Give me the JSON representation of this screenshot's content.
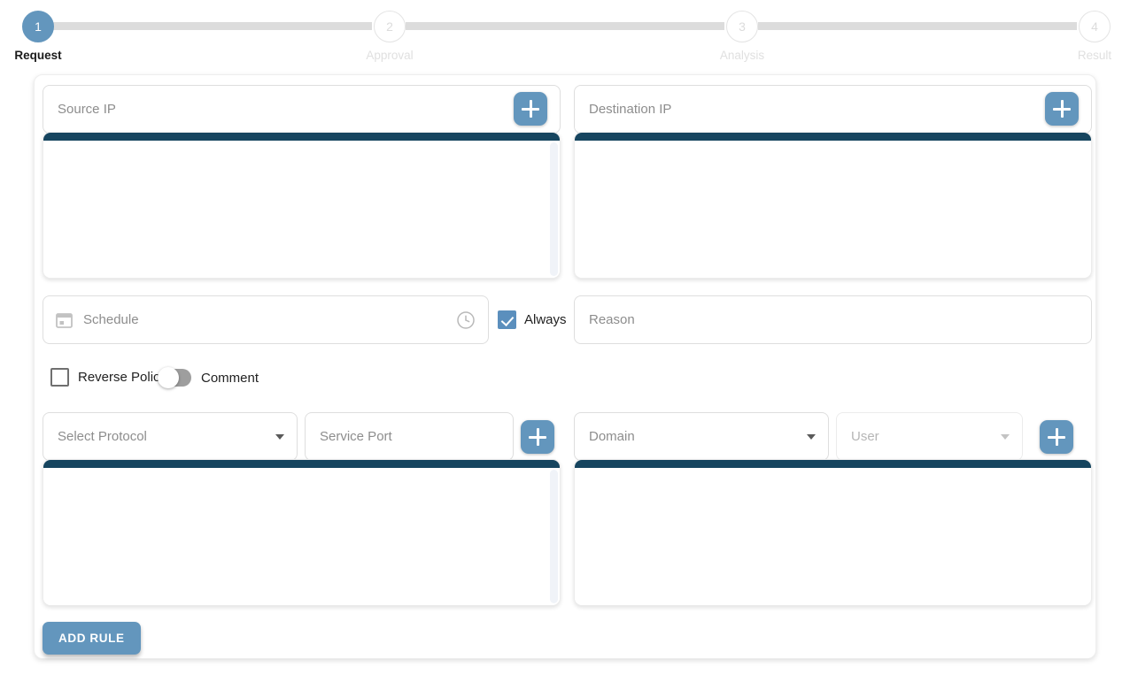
{
  "stepper": {
    "steps": [
      {
        "number": "1",
        "label": "Request",
        "state": "active"
      },
      {
        "number": "2",
        "label": "Approval",
        "state": "inactive"
      },
      {
        "number": "3",
        "label": "Analysis",
        "state": "inactive"
      },
      {
        "number": "4",
        "label": "Result",
        "state": "inactive"
      }
    ]
  },
  "form": {
    "source_ip": {
      "placeholder": "Source IP",
      "value": "",
      "add_button_label": "+"
    },
    "destination_ip": {
      "placeholder": "Destination IP",
      "value": "",
      "add_button_label": "+"
    },
    "source_list": {
      "items": []
    },
    "destination_list": {
      "items": []
    },
    "schedule": {
      "placeholder": "Schedule",
      "value": "",
      "calendar_icon": "calendar-icon",
      "clock_icon": "clock-icon"
    },
    "always": {
      "label": "Always",
      "checked": true
    },
    "reason": {
      "placeholder": "Reason",
      "value": ""
    },
    "reverse_policy": {
      "label": "Reverse Policy",
      "checked": false
    },
    "comment": {
      "label": "Comment",
      "enabled": false
    },
    "protocol": {
      "placeholder": "Select Protocol",
      "value": "",
      "options": []
    },
    "service_port": {
      "placeholder": "Service Port",
      "value": ""
    },
    "service_add_button_label": "+",
    "domain": {
      "placeholder": "Domain",
      "value": "",
      "options": []
    },
    "user": {
      "placeholder": "User",
      "value": "",
      "options": [],
      "disabled": true
    },
    "user_add_button_label": "+",
    "service_list": {
      "items": []
    },
    "domain_list": {
      "items": []
    },
    "add_rule_button_label": "ADD RULE"
  },
  "colors": {
    "accent_blue": "#6396bd",
    "checkbox_blue": "#5b8fbd",
    "listbox_header_navy": "#16455f",
    "connector_gray": "#dcdcdc",
    "inactive_text": "#e0e0e0"
  }
}
